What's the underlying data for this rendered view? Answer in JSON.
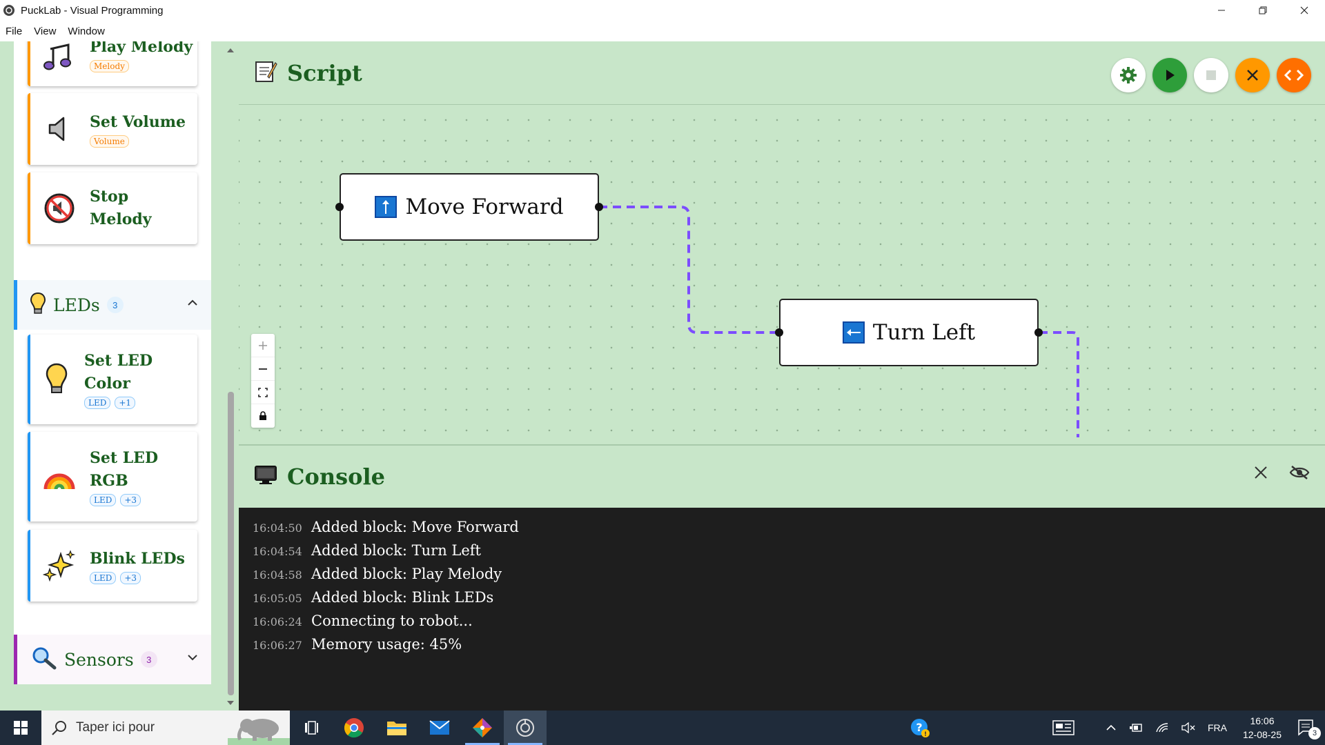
{
  "window": {
    "title": "PuckLab - Visual Programming",
    "controls": [
      "minimize",
      "restore",
      "close"
    ]
  },
  "menu": {
    "items": [
      "File",
      "View",
      "Window"
    ]
  },
  "sidebar": {
    "sound_blocks": [
      {
        "label": "Play Melody",
        "tags": [
          "Melody"
        ],
        "icon": "music-notes-icon"
      },
      {
        "label": "Set Volume",
        "tags": [
          "Volume"
        ],
        "icon": "speaker-icon"
      },
      {
        "label": "Stop Melody",
        "tags": [],
        "icon": "mute-icon"
      }
    ],
    "leds_category": {
      "title": "LEDs",
      "count": "3",
      "expanded": true
    },
    "led_blocks": [
      {
        "label": "Set LED Color",
        "tags": [
          "LED",
          "+1"
        ],
        "icon": "lightbulb-icon"
      },
      {
        "label": "Set LED RGB",
        "tags": [
          "LED",
          "+3"
        ],
        "icon": "rainbow-icon"
      },
      {
        "label": "Blink LEDs",
        "tags": [
          "LED",
          "+3"
        ],
        "icon": "sparkles-icon"
      }
    ],
    "sensors_category": {
      "title": "Sensors",
      "count": "3",
      "expanded": false
    }
  },
  "script": {
    "title": "Script",
    "toolbar": [
      "settings",
      "run",
      "stop",
      "clear",
      "code"
    ],
    "blocks": [
      {
        "label": "Move Forward",
        "icon": "arrow-up-icon"
      },
      {
        "label": "Turn Left",
        "icon": "arrow-left-icon"
      }
    ],
    "zoom_controls": [
      "+",
      "−",
      "fit",
      "lock"
    ]
  },
  "console": {
    "title": "Console",
    "logs": [
      {
        "time": "16:04:50",
        "message": "Added block: Move Forward"
      },
      {
        "time": "16:04:54",
        "message": "Added block: Turn Left"
      },
      {
        "time": "16:04:58",
        "message": "Added block: Play Melody"
      },
      {
        "time": "16:05:05",
        "message": "Added block: Blink LEDs"
      },
      {
        "time": "16:06:24",
        "message": "Connecting to robot..."
      },
      {
        "time": "16:06:27",
        "message": "Memory usage: 45%"
      }
    ]
  },
  "taskbar": {
    "search_placeholder": "Taper ici pour",
    "language": "FRA",
    "time": "16:06",
    "date": "12-08-25",
    "notifications": "3"
  },
  "colors": {
    "background": "#c8e6c9",
    "title_green": "#1b5e20",
    "run_green": "#2e9e3a",
    "orange": "#ff9800",
    "connector_purple": "#7c4dff",
    "console_bg": "#1e1e1e"
  }
}
